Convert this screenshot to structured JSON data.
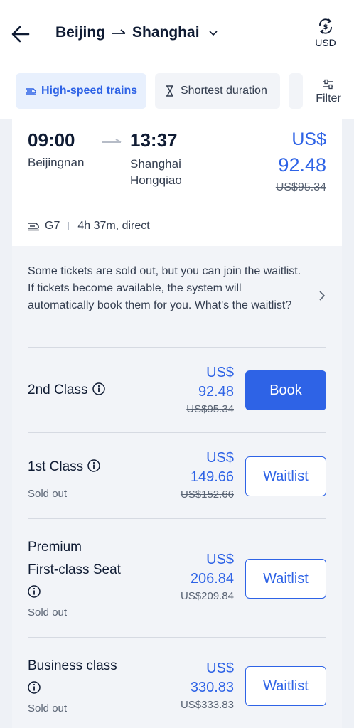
{
  "header": {
    "route_from": "Beijing",
    "route_to": "Shanghai",
    "currency": "USD"
  },
  "filters": {
    "chip_high_speed": "High-speed trains",
    "chip_shortest": "Shortest duration",
    "filter_label": "Filter"
  },
  "train": {
    "depart_time": "09:00",
    "arrive_time": "13:37",
    "depart_station": "Beijingnan",
    "arrive_station_line1": "Shanghai",
    "arrive_station_line2": "Hongqiao",
    "price_currency": "US$",
    "price": "92.48",
    "price_old": "US$95.34",
    "train_no": "G7",
    "duration": "4h 37m, direct"
  },
  "waitlist_note": "Some tickets are sold out, but you can join the waitlist. If tickets become available, the system will automatically book them for you. What's the waitlist?",
  "seats": [
    {
      "name": "2nd Class",
      "status": "",
      "currency": "US$",
      "price": "92.48",
      "price_old": "US$95.34",
      "action": "Book"
    },
    {
      "name": "1st Class",
      "status": "Sold out",
      "currency": "US$",
      "price": "149.66",
      "price_old": "US$152.66",
      "action": "Waitlist"
    },
    {
      "name_line1": "Premium",
      "name_line2": "First-class Seat",
      "status": "Sold out",
      "currency": "US$",
      "price": "206.84",
      "price_old": "US$209.84",
      "action": "Waitlist"
    },
    {
      "name": "Business class",
      "status": "Sold out",
      "currency": "US$",
      "price": "330.83",
      "price_old": "US$333.83",
      "action": "Waitlist"
    }
  ],
  "colors": {
    "accent": "#2e63e6",
    "text": "#0f1b33",
    "muted": "#5a6474",
    "background": "#eef1f6"
  }
}
